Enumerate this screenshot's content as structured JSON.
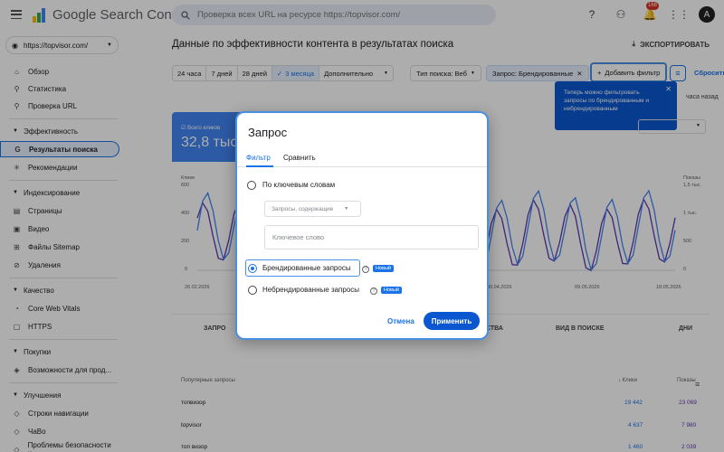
{
  "header": {
    "logo_text": "Google Search Console",
    "search_placeholder": "Проверка всех URL на ресурсе https://topvisor.com/",
    "notification_count": "168",
    "avatar_letter": "A"
  },
  "sidebar": {
    "property": "https://topvisor.com/",
    "items": [
      {
        "label": "Обзор"
      },
      {
        "label": "Статистика"
      },
      {
        "label": "Проверка URL"
      }
    ],
    "section_effectiveness": "Эффективность",
    "effectiveness_items": [
      {
        "label": "Результаты поиска"
      },
      {
        "label": "Рекомендации"
      }
    ],
    "section_indexing": "Индексирование",
    "indexing_items": [
      {
        "label": "Страницы"
      },
      {
        "label": "Видео"
      },
      {
        "label": "Файлы Sitemap"
      },
      {
        "label": "Удаления"
      }
    ],
    "section_quality": "Качество",
    "quality_items": [
      {
        "label": "Core Web Vitals"
      },
      {
        "label": "HTTPS"
      }
    ],
    "section_shopping": "Покупки",
    "shopping_items": [
      {
        "label": "Возможности для прод..."
      }
    ],
    "section_improvements": "Улучшения",
    "improvement_items": [
      {
        "label": "Строки навигации"
      },
      {
        "label": "ЧаВо"
      },
      {
        "label": "Проблемы безопасности и..."
      }
    ]
  },
  "main": {
    "title": "Данные по эффективности контента в результатах поиска",
    "export": "ЭКСПОРТИРОВАТЬ",
    "date_chips": [
      "24 часа",
      "7 дней",
      "28 дней",
      "3 месяца",
      "Дополнительно"
    ],
    "search_type_chip": "Тип поиска: Веб",
    "query_chip": "Запрос: Брендированные",
    "add_filter": "Добавить фильтр",
    "reset": "Сбросить",
    "tooltip": "Теперь можно фильтровать запросы по брендированным и небрендированным",
    "hours_ago": "часа назад",
    "card_label": "Всего кликов",
    "card_value": "32,8 тыс.",
    "chart_left_label": "Клики",
    "chart_right_label": "Показы",
    "chart_left_ticks": [
      "600",
      "400",
      "200",
      "0"
    ],
    "chart_right_ticks": [
      "1,5 тыс.",
      "1 тыс.",
      "500",
      "0"
    ],
    "chart_dates": [
      "26.02.2026",
      "30.04.2026",
      "09.05.2026",
      "18.05.2026"
    ],
    "chart_dates_mid": [
      "2026",
      "2026",
      "2026",
      "2026"
    ],
    "tabs": [
      "ЗАПРО",
      "СТВА",
      "ВИД В ПОИСКЕ",
      "ДНИ"
    ],
    "table_headers": {
      "query": "Популярные запросы",
      "clicks": "Клики",
      "impressions": "Показы"
    },
    "rows": [
      {
        "query": "топвизор",
        "clicks": "19 442",
        "impressions": "23 069"
      },
      {
        "query": "topvisor",
        "clicks": "4 637",
        "impressions": "7 980"
      },
      {
        "query": "топ визор",
        "clicks": "1 460",
        "impressions": "2 039"
      }
    ]
  },
  "dialog": {
    "title": "Запрос",
    "tabs": [
      "Фильтр",
      "Сравнить"
    ],
    "option_keywords": "По ключевым словам",
    "dropdown": "Запросы, содержащие",
    "keyword_placeholder": "Ключевое слово",
    "option_branded": "Брендированные запросы",
    "option_nonbranded": "Небрендированные запросы",
    "new_badge": "Новый",
    "cancel": "Отмена",
    "apply": "Применить"
  },
  "colors": {
    "accent": "#1a73e8",
    "clicks": "#4285f4",
    "impressions": "#5e35b1"
  }
}
